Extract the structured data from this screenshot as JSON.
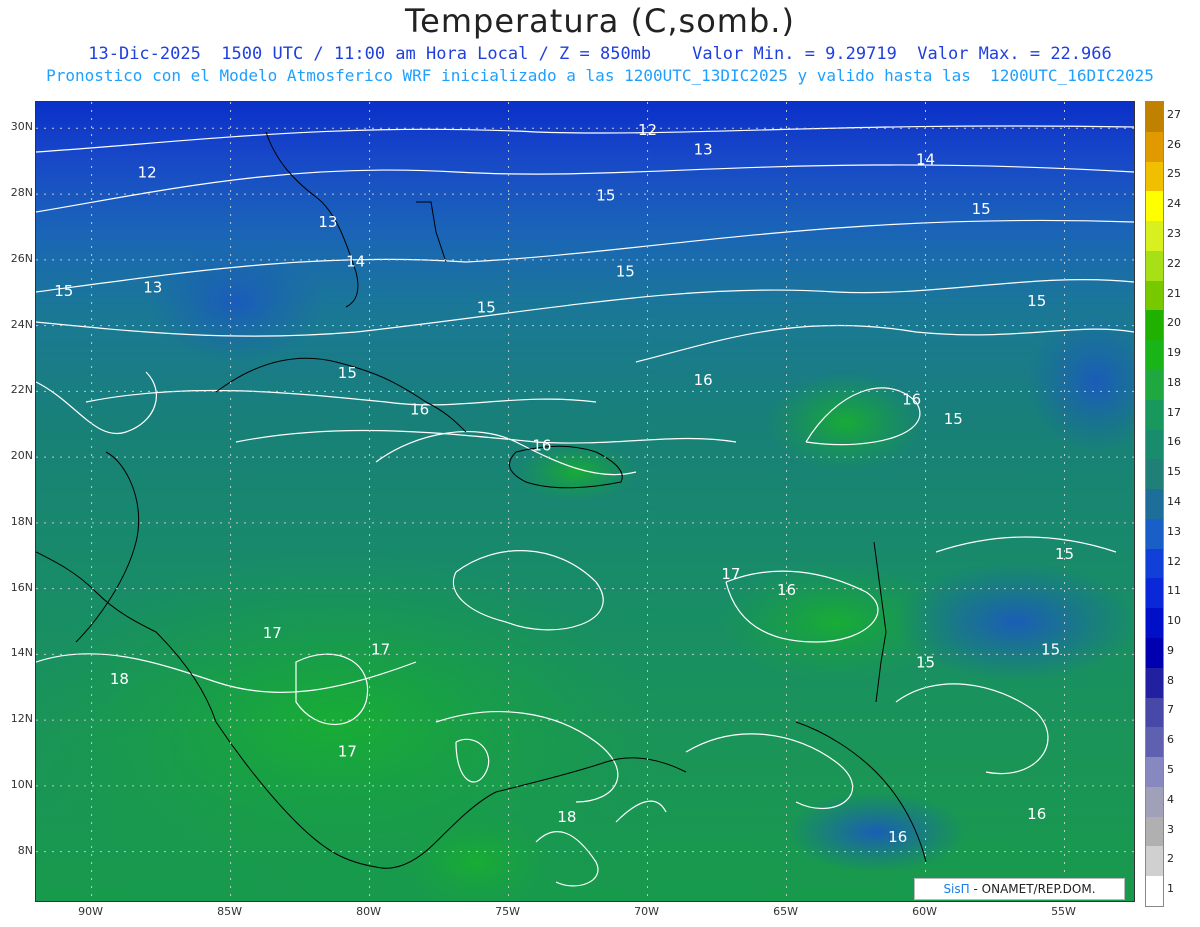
{
  "header": {
    "title": "Temperatura (C,somb.)",
    "subtitle_line1": "13-Dic-2025  1500 UTC / 11:00 am Hora Local / Z = 850mb    Valor Min. = 9.29719  Valor Max. = 22.966",
    "subtitle_line2": "Pronostico con el Modelo Atmosferico WRF inicializado a las 1200UTC_13DIC2025 y valido hasta las  1200UTC_16DIC2025"
  },
  "map": {
    "lat_labels": [
      "30N",
      "28N",
      "26N",
      "24N",
      "22N",
      "20N",
      "18N",
      "16N",
      "14N",
      "12N",
      "10N",
      "8N"
    ],
    "lon_labels": [
      "90W",
      "85W",
      "80W",
      "75W",
      "70W",
      "65W",
      "60W",
      "55W"
    ],
    "contour_labels": [
      {
        "text": "12",
        "lat": 29.8,
        "lon": -70.0
      },
      {
        "text": "13",
        "lat": 29.2,
        "lon": -68.0
      },
      {
        "text": "14",
        "lat": 28.9,
        "lon": -60.0
      },
      {
        "text": "12",
        "lat": 28.5,
        "lon": -88.0
      },
      {
        "text": "15",
        "lat": 27.8,
        "lon": -71.5
      },
      {
        "text": "15",
        "lat": 27.4,
        "lon": -58.0
      },
      {
        "text": "13",
        "lat": 27.0,
        "lon": -81.5
      },
      {
        "text": "14",
        "lat": 25.8,
        "lon": -80.5
      },
      {
        "text": "15",
        "lat": 25.5,
        "lon": -70.8
      },
      {
        "text": "15",
        "lat": 24.9,
        "lon": -91.0
      },
      {
        "text": "13",
        "lat": 25.0,
        "lon": -87.8
      },
      {
        "text": "15",
        "lat": 24.4,
        "lon": -75.8
      },
      {
        "text": "15",
        "lat": 24.6,
        "lon": -56.0
      },
      {
        "text": "15",
        "lat": 22.4,
        "lon": -80.8
      },
      {
        "text": "16",
        "lat": 22.2,
        "lon": -68.0
      },
      {
        "text": "16",
        "lat": 21.6,
        "lon": -60.5
      },
      {
        "text": "15",
        "lat": 21.0,
        "lon": -59.0
      },
      {
        "text": "16",
        "lat": 21.3,
        "lon": -78.2
      },
      {
        "text": "16",
        "lat": 20.2,
        "lon": -73.8
      },
      {
        "text": "15",
        "lat": 16.9,
        "lon": -55.0
      },
      {
        "text": "17",
        "lat": 16.3,
        "lon": -67.0
      },
      {
        "text": "16",
        "lat": 15.8,
        "lon": -65.0
      },
      {
        "text": "17",
        "lat": 14.5,
        "lon": -83.5
      },
      {
        "text": "17",
        "lat": 14.0,
        "lon": -79.6
      },
      {
        "text": "15",
        "lat": 14.0,
        "lon": -55.5
      },
      {
        "text": "15",
        "lat": 13.6,
        "lon": -60.0
      },
      {
        "text": "18",
        "lat": 13.1,
        "lon": -89.0
      },
      {
        "text": "17",
        "lat": 10.9,
        "lon": -80.8
      },
      {
        "text": "18",
        "lat": 8.9,
        "lon": -72.9
      },
      {
        "text": "16",
        "lat": 9.0,
        "lon": -56.0
      },
      {
        "text": "16",
        "lat": 8.3,
        "lon": -61.0
      }
    ]
  },
  "colorbar": {
    "labels": [
      "27",
      "26",
      "25",
      "24",
      "23",
      "22",
      "21",
      "20",
      "19",
      "18",
      "17",
      "16",
      "15",
      "14",
      "13",
      "12",
      "11",
      "10",
      "9",
      "8",
      "7",
      "6",
      "5",
      "4",
      "3",
      "2",
      "1"
    ],
    "colors": [
      "#c08000",
      "#e09a00",
      "#f0c000",
      "#ffff00",
      "#d8f020",
      "#a8e018",
      "#78c800",
      "#20b000",
      "#18b418",
      "#20a840",
      "#18985c",
      "#188c6c",
      "#208078",
      "#1e6e9a",
      "#1a5ec8",
      "#1040d8",
      "#0a28d8",
      "#0010c8",
      "#0000b0",
      "#2020a0",
      "#4848a8",
      "#6060b0",
      "#8888c0",
      "#a0a0b8",
      "#b0b0b0",
      "#d0d0d0",
      "#ffffff"
    ]
  },
  "credit": {
    "brand": "SisΠ",
    "text": "- ONAMET/REP.DOM."
  }
}
